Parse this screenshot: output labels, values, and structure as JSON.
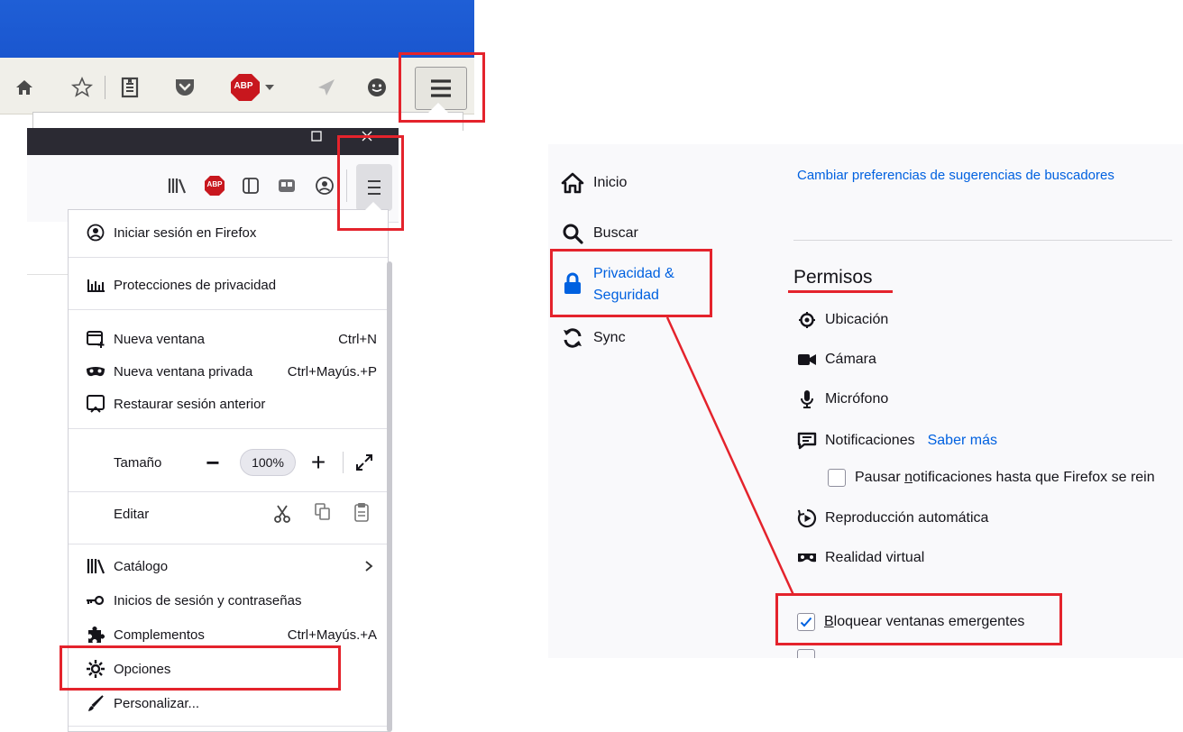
{
  "app_menu": {
    "items": [
      {
        "label": "Iniciar sesión en Firefox",
        "shortcut": ""
      },
      {
        "label": "Protecciones de privacidad",
        "shortcut": ""
      },
      {
        "label": "Nueva ventana",
        "shortcut": "Ctrl+N"
      },
      {
        "label": "Nueva ventana privada",
        "shortcut": "Ctrl+Mayús.+P"
      },
      {
        "label": "Restaurar sesión anterior",
        "shortcut": ""
      },
      {
        "label": "Catálogo",
        "shortcut": ""
      },
      {
        "label": "Inicios de sesión y contraseñas",
        "shortcut": ""
      },
      {
        "label": "Complementos",
        "shortcut": "Ctrl+Mayús.+A"
      },
      {
        "label": "Opciones",
        "shortcut": ""
      },
      {
        "label": "Personalizar...",
        "shortcut": ""
      }
    ],
    "zoom": {
      "label": "Tamaño",
      "value": "100%",
      "minus": "−",
      "plus": "+"
    },
    "edit": {
      "label": "Editar"
    }
  },
  "old_toolbar": {
    "abp_label": "ABP"
  },
  "new_toolbar": {
    "abp_label": "ABP"
  },
  "settings": {
    "nav": [
      {
        "label": "Inicio"
      },
      {
        "label": "Buscar"
      },
      {
        "label": "Privacidad &"
      },
      {
        "label": "Seguridad"
      },
      {
        "label": "Sync"
      }
    ],
    "search_link": "Cambiar preferencias de sugerencias de buscadores",
    "section_title": "Permisos",
    "permissions": [
      {
        "label": "Ubicación"
      },
      {
        "label": "Cámara"
      },
      {
        "label": "Micrófono"
      },
      {
        "label": "Notificaciones"
      },
      {
        "label": "Reproducción automática"
      },
      {
        "label": "Realidad virtual"
      }
    ],
    "learn_more": "Saber más",
    "pause_notifications": {
      "pre": "Pausar ",
      "access": "n",
      "post": "otificaciones hasta que Firefox se rein"
    },
    "block_popups": {
      "access": "B",
      "post": "loquear ventanas emergentes"
    },
    "colors": {
      "accent": "#0061e0",
      "highlight": "#e4232c"
    }
  }
}
